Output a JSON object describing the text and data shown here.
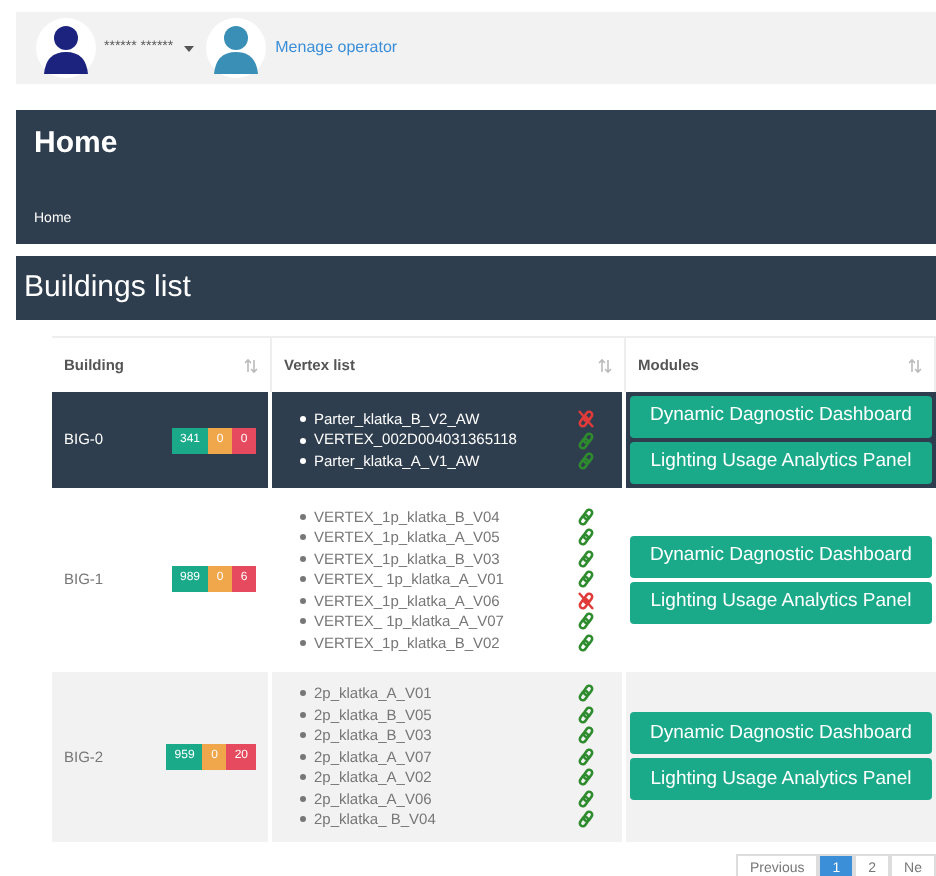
{
  "top_bar": {
    "user_name": "****** ******",
    "operator_link": "Menage operator"
  },
  "page_header": {
    "title": "Home",
    "breadcrumb": "Home"
  },
  "section": {
    "title": "Buildings list"
  },
  "table": {
    "columns": [
      "Building",
      "Vertex list",
      "Modules"
    ],
    "rows": [
      {
        "building": "BIG-0",
        "selected": true,
        "counts": [
          {
            "value": "341",
            "color": "#1aaa8a"
          },
          {
            "value": "0",
            "color": "#f0a64a"
          },
          {
            "value": "0",
            "color": "#e64a5e"
          }
        ],
        "vertices": [
          {
            "name": "Parter_klatka_B_V2_AW",
            "kind": "broken"
          },
          {
            "name": "VERTEX_002D004031365118",
            "kind": "ok"
          },
          {
            "name": "Parter_klatka_A_V1_AW",
            "kind": "ok"
          }
        ],
        "modules": [
          "Dynamic Dagnostic Dashboard",
          "Lighting Usage Analytics Panel"
        ]
      },
      {
        "building": "BIG-1",
        "selected": false,
        "counts": [
          {
            "value": "989",
            "color": "#1aaa8a"
          },
          {
            "value": "0",
            "color": "#f0a64a"
          },
          {
            "value": "6",
            "color": "#e64a5e"
          }
        ],
        "vertices": [
          {
            "name": "VERTEX_1p_klatka_B_V04",
            "kind": "ok"
          },
          {
            "name": "VERTEX_1p_klatka_A_V05",
            "kind": "ok"
          },
          {
            "name": "VERTEX_1p_klatka_B_V03",
            "kind": "ok"
          },
          {
            "name": "VERTEX_ 1p_klatka_A_V01",
            "kind": "ok"
          },
          {
            "name": "VERTEX_1p_klatka_A_V06",
            "kind": "broken"
          },
          {
            "name": "VERTEX_ 1p_klatka_A_V07",
            "kind": "ok"
          },
          {
            "name": "VERTEX_1p_klatka_B_V02",
            "kind": "ok"
          }
        ],
        "modules": [
          "Dynamic Dagnostic Dashboard",
          "Lighting Usage Analytics Panel"
        ]
      },
      {
        "building": "BIG-2",
        "selected": false,
        "counts": [
          {
            "value": "959",
            "color": "#1aaa8a"
          },
          {
            "value": "0",
            "color": "#f0a64a"
          },
          {
            "value": "20",
            "color": "#e64a5e"
          }
        ],
        "vertices": [
          {
            "name": "2p_klatka_A_V01",
            "kind": "ok"
          },
          {
            "name": "2p_klatka_B_V05",
            "kind": "ok"
          },
          {
            "name": "2p_klatka_B_V03",
            "kind": "ok"
          },
          {
            "name": "2p_klatka_A_V07",
            "kind": "ok"
          },
          {
            "name": "2p_klatka_A_V02",
            "kind": "ok"
          },
          {
            "name": "2p_klatka_A_V06",
            "kind": "ok"
          },
          {
            "name": "2p_klatka_ B_V04",
            "kind": "ok"
          }
        ],
        "modules": [
          "Dynamic Dagnostic Dashboard",
          "Lighting Usage Analytics Panel"
        ]
      }
    ]
  },
  "pagination": [
    {
      "label": "Previous",
      "selected": false
    },
    {
      "label": "1",
      "selected": true
    },
    {
      "label": "2",
      "selected": false
    },
    {
      "label": "Ne",
      "selected": false
    }
  ]
}
